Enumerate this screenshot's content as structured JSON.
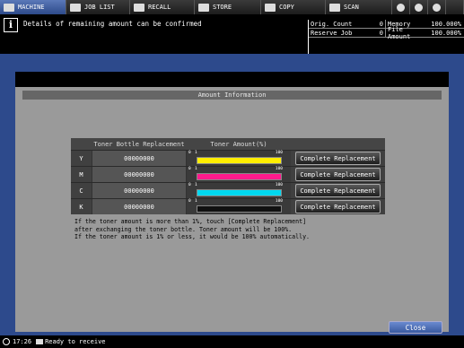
{
  "tabs": [
    {
      "label": "MACHINE",
      "icon": "machine-icon",
      "active": true
    },
    {
      "label": "JOB LIST",
      "icon": "job-list-icon"
    },
    {
      "label": "RECALL",
      "icon": "recall-icon"
    },
    {
      "label": "STORE",
      "icon": "store-icon"
    },
    {
      "label": "COPY",
      "icon": "copy-icon"
    },
    {
      "label": "SCAN",
      "icon": "scan-icon"
    }
  ],
  "message": {
    "icon": "i",
    "text": "Details of remaining amount can be confirmed"
  },
  "status": {
    "orig_count_label": "Orig. Count",
    "orig_count_value": "0",
    "reserve_job_label": "Reserve Job",
    "reserve_job_value": "0",
    "memory_label": "Memory",
    "memory_value": "100.000%",
    "file_amount_label": "File Amount",
    "file_amount_value": "100.000%"
  },
  "panel": {
    "title": "Amount Information",
    "col_bottle": "Toner Bottle Replacement",
    "col_amount": "Toner Amount(%)",
    "tick_0": "0",
    "tick_1": "1",
    "tick_100": "100",
    "rows": [
      {
        "code": "Y",
        "bottle": "00000000",
        "level": 1.0,
        "color": "#ffee00",
        "button": "Complete Replacement"
      },
      {
        "code": "M",
        "bottle": "00000000",
        "level": 1.0,
        "color": "#ff1a8c",
        "button": "Complete Replacement"
      },
      {
        "code": "C",
        "bottle": "00000000",
        "level": 1.0,
        "color": "#00d8f0",
        "button": "Complete Replacement"
      },
      {
        "code": "K",
        "bottle": "00000000",
        "level": 1.0,
        "color": "#111111",
        "button": "Complete Replacement"
      }
    ],
    "note_1": "If the toner amount is more than 1%, touch [Complete Replacement]",
    "note_2": "after exchanging the toner bottle. Toner amount will be 100%.",
    "note_3": "If the toner amount is 1% or less, it would be 100% automatically."
  },
  "close_label": "Close",
  "statusbar": {
    "time": "17:26",
    "text": "Ready to receive"
  }
}
